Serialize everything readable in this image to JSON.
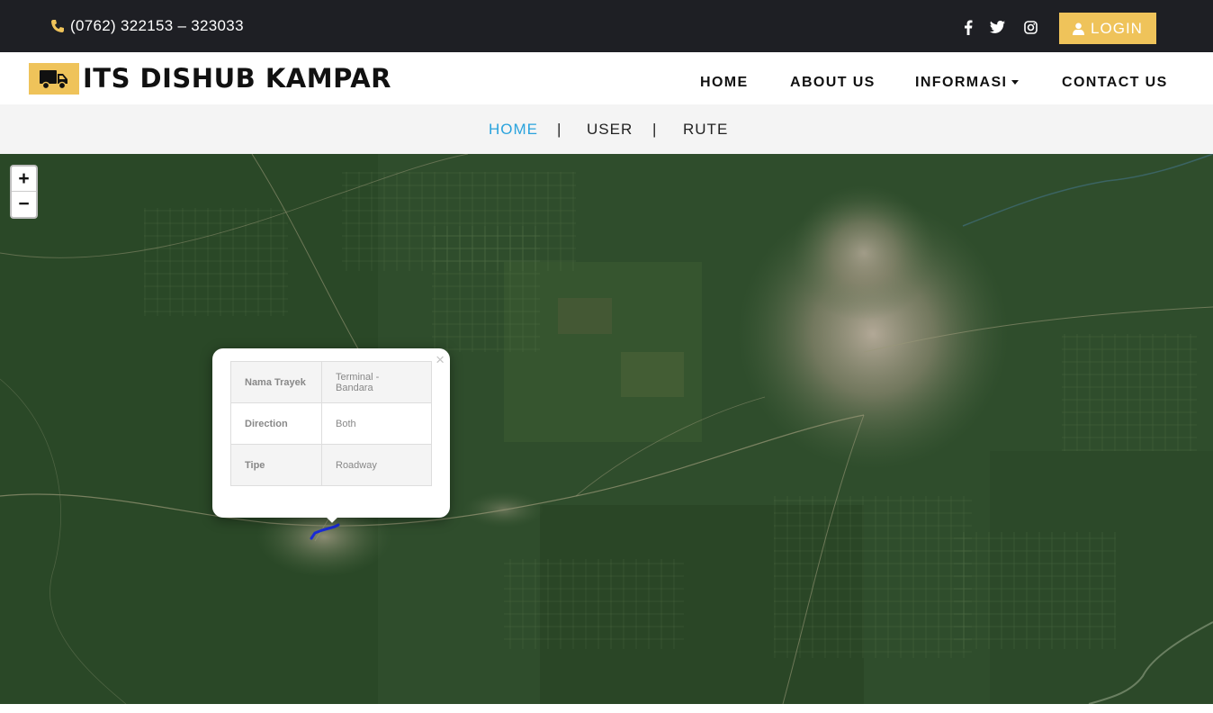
{
  "topbar": {
    "phone": "(0762) 322153 – 323033",
    "social": [
      "facebook-icon",
      "twitter-icon",
      "instagram-icon"
    ],
    "login_label": "LOGIN"
  },
  "header": {
    "logo_icon": "truck-icon",
    "title": "ITS DISHUB KAMPAR",
    "nav": {
      "home": "HOME",
      "about": "ABOUT US",
      "informasi": "INFORMASI",
      "contact": "CONTACT US"
    }
  },
  "subnav": {
    "home": "HOME",
    "user": "USER",
    "rute": "RUTE",
    "separator": "|"
  },
  "map": {
    "zoom_in": "+",
    "zoom_out": "−",
    "popup": {
      "close": "×",
      "rows": [
        {
          "key": "Nama Trayek",
          "value": "Terminal - Bandara"
        },
        {
          "key": "Direction",
          "value": "Both"
        },
        {
          "key": "Tipe",
          "value": "Roadway"
        }
      ]
    },
    "route_color": "#1a2bd6"
  },
  "colors": {
    "accent": "#efc35a",
    "topbar_bg": "#1e1f24",
    "active_link": "#2aa3dd"
  }
}
